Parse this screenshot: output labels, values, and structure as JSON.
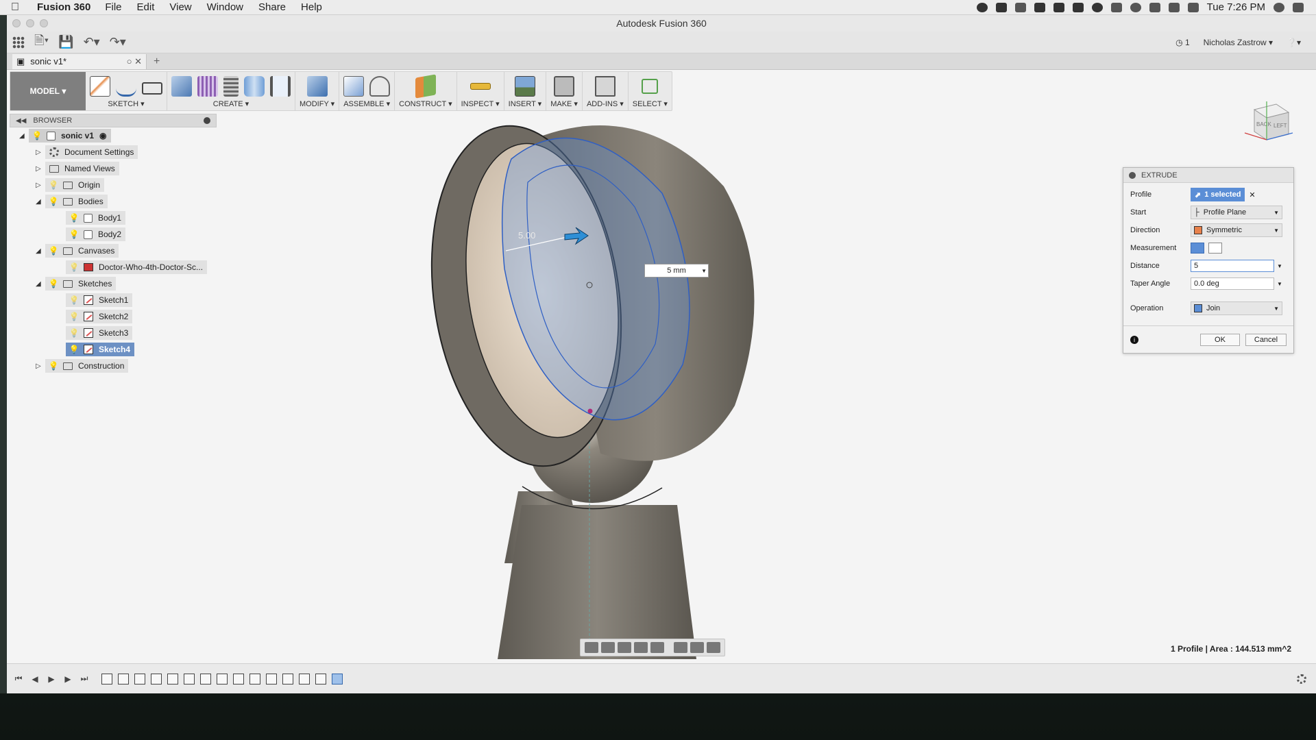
{
  "menubar": {
    "app_name": "Fusion 360",
    "items": [
      "File",
      "Edit",
      "View",
      "Window",
      "Share",
      "Help"
    ],
    "clock": "Tue 7:26 PM"
  },
  "window": {
    "title": "Autodesk Fusion 360"
  },
  "quickaccess": {
    "jobs_count": "1",
    "user": "Nicholas Zastrow"
  },
  "document_tab": {
    "label": "sonic v1*"
  },
  "toolbar": {
    "workspace": "MODEL",
    "groups": [
      "SKETCH",
      "CREATE",
      "MODIFY",
      "ASSEMBLE",
      "CONSTRUCT",
      "INSPECT",
      "INSERT",
      "MAKE",
      "ADD-INS",
      "SELECT"
    ]
  },
  "browser": {
    "title": "BROWSER",
    "root": "sonic v1",
    "items": {
      "document_settings": "Document Settings",
      "named_views": "Named Views",
      "origin": "Origin",
      "bodies": "Bodies",
      "body1": "Body1",
      "body2": "Body2",
      "canvases": "Canvases",
      "canvas1": "Doctor-Who-4th-Doctor-Sc...",
      "sketches": "Sketches",
      "sketch1": "Sketch1",
      "sketch2": "Sketch2",
      "sketch3": "Sketch3",
      "sketch4": "Sketch4",
      "construction": "Construction"
    }
  },
  "viewport": {
    "dimension_label": "5.00",
    "distance_input": "5 mm",
    "status": "1 Profile | Area : 144.513 mm^2"
  },
  "viewcube": {
    "faces": [
      "BACK",
      "LEFT"
    ]
  },
  "extrude": {
    "title": "EXTRUDE",
    "rows": {
      "profile_label": "Profile",
      "profile_value": "1 selected",
      "start_label": "Start",
      "start_value": "Profile Plane",
      "direction_label": "Direction",
      "direction_value": "Symmetric",
      "measurement_label": "Measurement",
      "distance_label": "Distance",
      "distance_value": "5",
      "taper_label": "Taper Angle",
      "taper_value": "0.0 deg",
      "operation_label": "Operation",
      "operation_value": "Join"
    },
    "ok": "OK",
    "cancel": "Cancel"
  },
  "colors": {
    "accent": "#5b8ed6",
    "selection_blue": "#6d91c4",
    "model_gray": "#7d776d"
  }
}
